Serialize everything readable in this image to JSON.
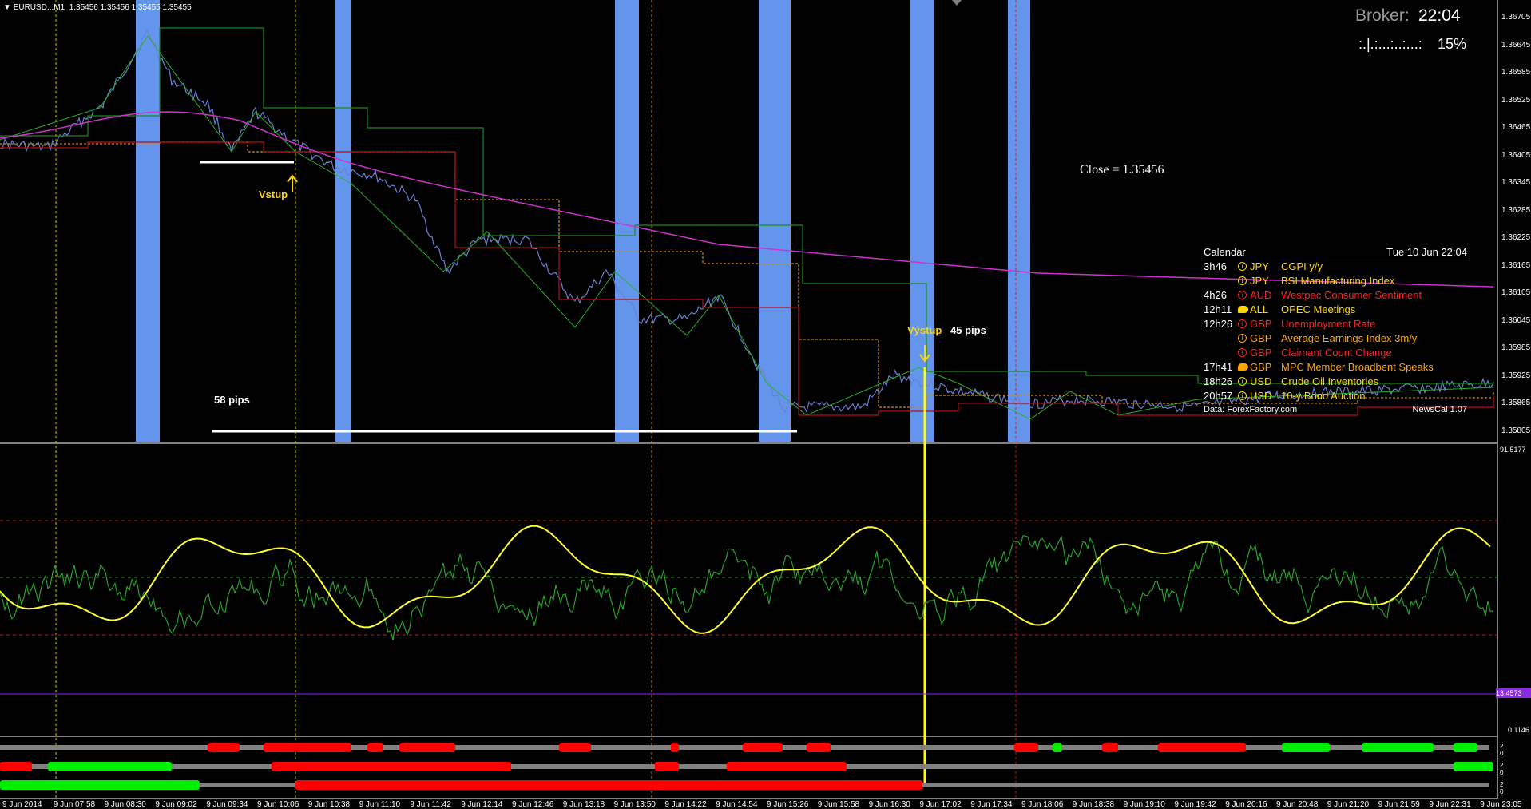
{
  "header": {
    "symbol": "EURUSD...M1",
    "ohlc": "1.35456 1.35456 1.35455 1.35455"
  },
  "broker": {
    "label": "Broker:",
    "time": "22:04",
    "progress_text": ":.|.:...:..:...:",
    "progress_pct": "15%"
  },
  "close_label": "Close = 1.35456",
  "annotations": {
    "entry": "Vstup",
    "exit": "Výstup",
    "exit_pips": "45 pips",
    "move_pips": "58 pips"
  },
  "calendar": {
    "title": "Calendar",
    "date": "Tue 10 Jun 22:04",
    "source": "Data: ForexFactory.com",
    "version": "NewsCal 1.07",
    "events": [
      {
        "time": "3h46",
        "icon": "info-icon",
        "currency": "JPY",
        "event": "CGPI y/y",
        "color": "#ffd700"
      },
      {
        "time": "",
        "icon": "info-icon",
        "currency": "JPY",
        "event": "BSI Manufacturing Index",
        "color": "#ffd700"
      },
      {
        "time": "4h26",
        "icon": "info-icon",
        "currency": "AUD",
        "event": "Westpac Consumer Sentiment",
        "color": "#ff2020"
      },
      {
        "time": "12h11",
        "icon": "speech-icon",
        "currency": "ALL",
        "event": "OPEC Meetings",
        "color": "#ffd700"
      },
      {
        "time": "12h26",
        "icon": "info-icon",
        "currency": "GBP",
        "event": "Unemployment Rate",
        "color": "#ff2020"
      },
      {
        "time": "",
        "icon": "info-icon",
        "currency": "GBP",
        "event": "Average Earnings Index 3m/y",
        "color": "#ffa500"
      },
      {
        "time": "",
        "icon": "info-icon",
        "currency": "GBP",
        "event": "Claimant Count Change",
        "color": "#ff2020"
      },
      {
        "time": "17h41",
        "icon": "speech-icon",
        "currency": "GBP",
        "event": "MPC Member Broadbent Speaks",
        "color": "#ffa500"
      },
      {
        "time": "18h26",
        "icon": "info-icon",
        "currency": "USD",
        "event": "Crude Oil Inventories",
        "color": "#ffd700"
      },
      {
        "time": "20h57",
        "icon": "info-icon",
        "currency": "USD",
        "event": "10-y Bond Auction",
        "color": "#ffd700"
      }
    ]
  },
  "price_axis": [
    "1.36705",
    "1.36645",
    "1.36585",
    "1.36525",
    "1.36465",
    "1.36405",
    "1.36345",
    "1.36285",
    "1.36225",
    "1.36165",
    "1.36105",
    "1.36045",
    "1.35985",
    "1.35925",
    "1.35865",
    "1.35805"
  ],
  "time_axis": [
    "9 Jun 2014",
    "9 Jun 07:58",
    "9 Jun 08:30",
    "9 Jun 09:02",
    "9 Jun 09:34",
    "9 Jun 10:06",
    "9 Jun 10:38",
    "9 Jun 11:10",
    "9 Jun 11:42",
    "9 Jun 12:14",
    "9 Jun 12:46",
    "9 Jun 13:18",
    "9 Jun 13:50",
    "9 Jun 14:22",
    "9 Jun 14:54",
    "9 Jun 15:26",
    "9 Jun 15:58",
    "9 Jun 16:30",
    "9 Jun 17:02",
    "9 Jun 17:34",
    "9 Jun 18:06",
    "9 Jun 18:38",
    "9 Jun 19:10",
    "9 Jun 19:42",
    "9 Jun 20:16",
    "9 Jun 20:48",
    "9 Jun 21:20",
    "9 Jun 21:59",
    "9 Jun 22:31",
    "9 Jun 23:05"
  ],
  "oscillator": {
    "top": "91.5177",
    "tag": "13.4573",
    "bottom": "0.1146"
  },
  "bar_axes": [
    [
      "2",
      "0"
    ],
    [
      "2",
      "0"
    ],
    [
      "2",
      "0"
    ]
  ],
  "colors": {
    "session_band": "#6495ed",
    "ma": "#cc33cc",
    "channel_green": "#1a8a1a",
    "channel_red": "#b01010",
    "channel_orange": "#d08a10",
    "osc_fast": "#2aa02a",
    "osc_slow": "#ffff33",
    "bar_red": "#ff0000",
    "bar_green": "#00ee00",
    "bar_gray": "#808080"
  }
}
